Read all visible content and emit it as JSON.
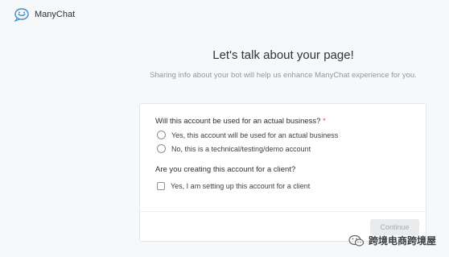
{
  "header": {
    "brand_name": "ManyChat",
    "logo_icon": "manychat-logo-icon"
  },
  "page": {
    "title": "Let's talk about your page!",
    "subtitle": "Sharing info about your bot will help us enhance ManyChat experience for you."
  },
  "form": {
    "q1": {
      "label": "Will this account be used for an actual business?",
      "required_mark": "*",
      "options": [
        "Yes, this account will be used for an actual business",
        "No, this is a technical/testing/demo account"
      ]
    },
    "q2": {
      "label": "Are you creating this account for a client?",
      "checkbox_label": "Yes, I am setting up this account for a client"
    },
    "continue_label": "Continue"
  },
  "watermark": {
    "text": "跨境电商跨境屋",
    "icon": "wechat-icon"
  },
  "colors": {
    "accent": "#3b8fd1",
    "required": "#e0454a",
    "background": "#f7f8fa"
  }
}
